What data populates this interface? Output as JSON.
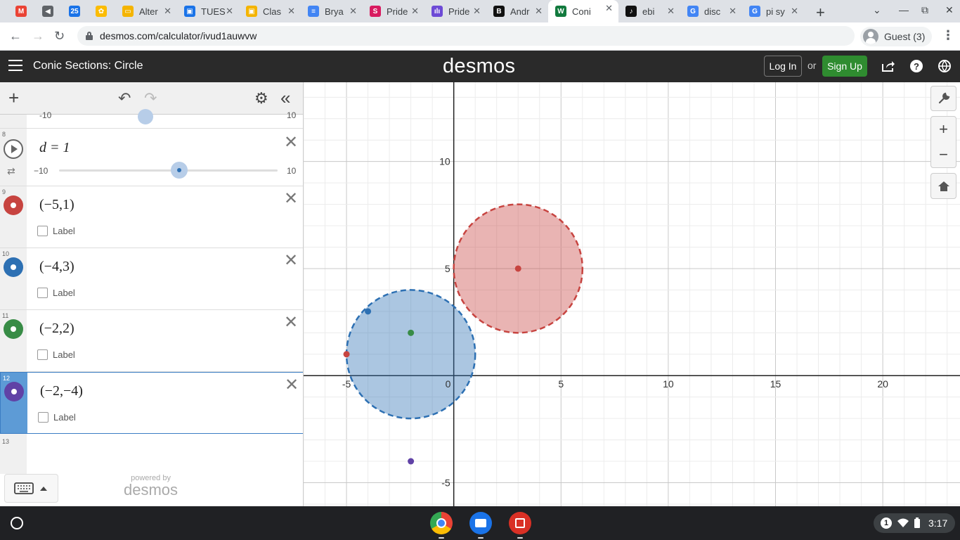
{
  "browser": {
    "tabs": [
      {
        "title": "",
        "icon": "gmail-icon",
        "color": "#ea4335",
        "glyph": "M"
      },
      {
        "title": "",
        "icon": "audio-icon",
        "color": "#5f6368",
        "glyph": "◀"
      },
      {
        "title": "",
        "icon": "calendar-icon",
        "color": "#1a73e8",
        "glyph": "25"
      },
      {
        "title": "",
        "icon": "photos-icon",
        "color": "#fbbc04",
        "glyph": "✿"
      },
      {
        "title": "Alter",
        "icon": "slides-icon",
        "color": "#f4b400",
        "glyph": "▭"
      },
      {
        "title": "TUES",
        "icon": "classroom-icon",
        "color": "#1a73e8",
        "glyph": "▣"
      },
      {
        "title": "Clas",
        "icon": "classroom-icon",
        "color": "#f4b400",
        "glyph": "▣"
      },
      {
        "title": "Brya",
        "icon": "docs-icon",
        "color": "#4285f4",
        "glyph": "≡"
      },
      {
        "title": "Pride",
        "icon": "site-icon",
        "color": "#d81b60",
        "glyph": "S"
      },
      {
        "title": "Pride",
        "icon": "chart-icon",
        "color": "#6d4ad6",
        "glyph": "ılı"
      },
      {
        "title": "Andr",
        "icon": "brainly-icon",
        "color": "#111111",
        "glyph": "B"
      },
      {
        "title": "Coni",
        "icon": "desmos-icon",
        "color": "#127a3e",
        "glyph": "W",
        "active": true
      },
      {
        "title": "ebi",
        "icon": "tiktok-icon",
        "color": "#111111",
        "glyph": "♪"
      },
      {
        "title": "disc",
        "icon": "google-icon",
        "color": "#4285f4",
        "glyph": "G"
      },
      {
        "title": "pi sy",
        "icon": "google-icon",
        "color": "#4285f4",
        "glyph": "G"
      }
    ],
    "url": "desmos.com/calculator/ivud1auwvw",
    "profile_label": "Guest (3)"
  },
  "header": {
    "graph_title": "Conic Sections: Circle",
    "logo": "desmos",
    "login_label": "Log In",
    "or_label": "or",
    "signup_label": "Sign Up"
  },
  "panel": {
    "partial_slider": {
      "min": "-10",
      "max": "10"
    },
    "expressions": [
      {
        "num": "8",
        "kind": "slider",
        "latex": "d = 1",
        "min": "−10",
        "max": "10",
        "value": 1
      },
      {
        "num": "9",
        "kind": "point",
        "latex": "(−5,1)",
        "color": "#c74440",
        "label": "Label"
      },
      {
        "num": "10",
        "kind": "point",
        "latex": "(−4,3)",
        "color": "#2d70b3",
        "label": "Label"
      },
      {
        "num": "11",
        "kind": "point",
        "latex": "(−2,2)",
        "color": "#388c46",
        "label": "Label"
      },
      {
        "num": "12",
        "kind": "point",
        "latex": "(−2,−4)",
        "color": "#6042a6",
        "label": "Label",
        "selected": true
      },
      {
        "num": "13",
        "kind": "empty"
      }
    ],
    "powered_by": "powered by",
    "powered_logo": "desmos"
  },
  "graph": {
    "x_range": [
      -7.0,
      23.6
    ],
    "y_range": [
      -6.1,
      13.7
    ],
    "x_tick_labels": [
      "-5",
      "0",
      "5",
      "10",
      "15",
      "20"
    ],
    "y_tick_labels": [
      "10",
      "5",
      "-5"
    ],
    "circles": [
      {
        "center": [
          3,
          5
        ],
        "radius": 3,
        "color": "#c74440"
      },
      {
        "center": [
          -2,
          1
        ],
        "radius": 3,
        "color": "#2d70b3"
      }
    ],
    "points": [
      {
        "xy": [
          3,
          5
        ],
        "color": "#c74440"
      },
      {
        "xy": [
          -5,
          1
        ],
        "color": "#c74440"
      },
      {
        "xy": [
          -4,
          3
        ],
        "color": "#2d70b3"
      },
      {
        "xy": [
          -2,
          2
        ],
        "color": "#388c46"
      },
      {
        "xy": [
          -2,
          -4
        ],
        "color": "#6042a6"
      }
    ]
  },
  "taskbar": {
    "time": "3:17",
    "notifications": "1",
    "apps": [
      "chrome-icon",
      "files-icon",
      "gallery-icon"
    ]
  }
}
